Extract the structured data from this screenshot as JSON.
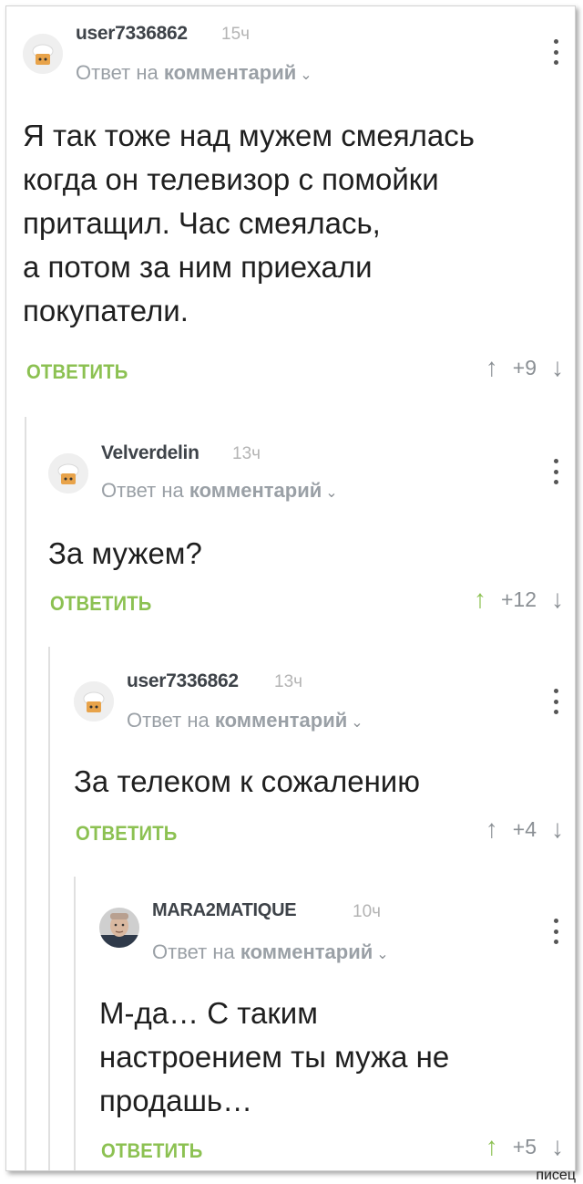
{
  "comments": [
    {
      "username": "user7336862",
      "time": "15ч",
      "reply_prefix": "Ответ на",
      "reply_target": "комментарий",
      "text": "Я так тоже над мужем смеялась\nкогда он телевизор с помойки\nпритащил. Час смеялась,\nа потом за ним приехали\nпокупатели.",
      "reply_label": "ОТВЕТИТЬ",
      "score": "+9",
      "upvoted": false,
      "avatar": "chef-hat-avatar-icon"
    },
    {
      "username": "Velverdelin",
      "time": "13ч",
      "reply_prefix": "Ответ на",
      "reply_target": "комментарий",
      "text": "За мужем?",
      "reply_label": "ОТВЕТИТЬ",
      "score": "+12",
      "upvoted": true,
      "avatar": "chef-hat-avatar-icon"
    },
    {
      "username": "user7336862",
      "time": "13ч",
      "reply_prefix": "Ответ на",
      "reply_target": "комментарий",
      "text": "За телеком к сожалению",
      "reply_label": "ОТВЕТИТЬ",
      "score": "+4",
      "upvoted": false,
      "avatar": "chef-hat-avatar-icon"
    },
    {
      "username": "MARA2MATIQUE",
      "time": "10ч",
      "reply_prefix": "Ответ на",
      "reply_target": "комментарий",
      "text": "М-да… С таким\nнастроением ты мужа не\nпродашь…",
      "reply_label": "ОТВЕТИТЬ",
      "score": "+5",
      "upvoted": true,
      "avatar": "user-photo-avatar"
    }
  ],
  "icons": {
    "up_arrow": "up-arrow-icon",
    "down_arrow": "down-arrow-icon",
    "more": "more-vertical-icon",
    "chevron": "chevron-down-icon"
  },
  "colors": {
    "accent_green": "#8cc152",
    "text_gray": "#9aa0a6"
  },
  "watermark": "писец"
}
